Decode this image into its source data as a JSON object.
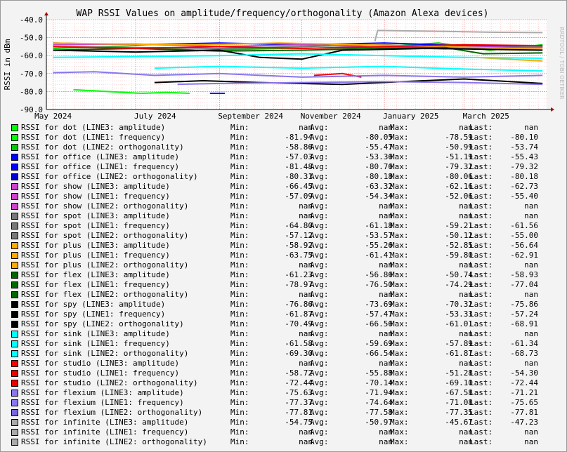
{
  "chart_data": {
    "type": "line",
    "title": "WAP RSSI Values on amplitude/frequency/orthogonality (Amazon Alexa devices)",
    "ylabel": "RSSI in dBm",
    "xlabel": "",
    "ylim": [
      -90,
      -40
    ],
    "y_ticks": [
      "-40.0",
      "-50.0",
      "-60.0",
      "-70.0",
      "-80.0",
      "-90.0"
    ],
    "x_ticks": [
      "May 2024",
      "July 2024",
      "September 2024",
      "November 2024",
      "January 2025",
      "March 2025"
    ],
    "x_range": [
      "2024-04-26",
      "2025-05-01"
    ],
    "grid": true,
    "watermark": "RRDTOOL / TOBI OETIKER",
    "stat_labels": [
      "Min:",
      "Avg:",
      "Max:",
      "Last:"
    ],
    "series": [
      {
        "name": "RSSI for dot (LINE3: amplitude)",
        "color": "#00ff00",
        "min": "nan",
        "avg": "nan",
        "max": "nan",
        "last": "nan",
        "points": []
      },
      {
        "name": "RSSI for dot (LINE1: frequency)",
        "color": "#00ff00",
        "min": "-81.94",
        "avg": "-80.05",
        "max": "-78.59",
        "last": "-80.10",
        "points": [
          [
            "2024-05-16",
            -79
          ],
          [
            "2024-06-10",
            -80
          ],
          [
            "2024-07-05",
            -81
          ],
          [
            "2024-07-25",
            -80.5
          ],
          [
            "2024-08-10",
            -81
          ]
        ]
      },
      {
        "name": "RSSI for dot (LINE2: orthogonality)",
        "color": "#00cc00",
        "min": "-58.86",
        "avg": "-55.47",
        "max": "-50.99",
        "last": "-53.74",
        "points": [
          [
            "2024-05-01",
            -56
          ],
          [
            "2024-06-15",
            -55
          ],
          [
            "2024-08-15",
            -57
          ],
          [
            "2024-10-15",
            -56
          ],
          [
            "2024-12-20",
            -55.5
          ],
          [
            "2025-02-10",
            -53
          ],
          [
            "2025-03-20",
            -57
          ],
          [
            "2025-04-28",
            -54
          ]
        ]
      },
      {
        "name": "RSSI for office (LINE3: amplitude)",
        "color": "#0000ff",
        "min": "-57.03",
        "avg": "-53.36",
        "max": "-51.19",
        "last": "-55.43",
        "points": [
          [
            "2024-05-01",
            -53
          ],
          [
            "2024-07-01",
            -54
          ],
          [
            "2024-09-01",
            -53
          ],
          [
            "2024-11-01",
            -54
          ],
          [
            "2025-01-01",
            -53
          ],
          [
            "2025-03-01",
            -54.5
          ],
          [
            "2025-04-28",
            -55
          ]
        ]
      },
      {
        "name": "RSSI for office (LINE1: frequency)",
        "color": "#0000ff",
        "min": "-81.48",
        "avg": "-80.76",
        "max": "-79.32",
        "last": "-79.32",
        "points": [
          [
            "2024-08-25",
            -81
          ],
          [
            "2024-09-05",
            -81
          ]
        ]
      },
      {
        "name": "RSSI for office (LINE2: orthogonality)",
        "color": "#0000cc",
        "min": "-80.31",
        "avg": "-80.18",
        "max": "-80.06",
        "last": "-80.18",
        "points": []
      },
      {
        "name": "RSSI for show (LINE3: amplitude)",
        "color": "#cc44cc",
        "min": "-66.45",
        "avg": "-63.32",
        "max": "-62.16",
        "last": "-62.73",
        "points": []
      },
      {
        "name": "RSSI for show (LINE1: frequency)",
        "color": "#cc44cc",
        "min": "-57.09",
        "avg": "-54.34",
        "max": "-52.06",
        "last": "-55.40",
        "points": [
          [
            "2024-05-01",
            -54
          ],
          [
            "2024-07-01",
            -53.5
          ],
          [
            "2024-09-01",
            -55
          ],
          [
            "2024-11-01",
            -54
          ],
          [
            "2025-01-01",
            -55.5
          ],
          [
            "2025-03-01",
            -55
          ],
          [
            "2025-04-28",
            -55.5
          ]
        ]
      },
      {
        "name": "RSSI for show (LINE2: orthogonality)",
        "color": "#cc44cc",
        "min": "nan",
        "avg": "nan",
        "max": "nan",
        "last": "nan",
        "points": []
      },
      {
        "name": "RSSI for spot (LINE3: amplitude)",
        "color": "#777777",
        "min": "nan",
        "avg": "nan",
        "max": "nan",
        "last": "nan",
        "points": []
      },
      {
        "name": "RSSI for spot (LINE1: frequency)",
        "color": "#777777",
        "min": "-64.80",
        "avg": "-61.18",
        "max": "-59.21",
        "last": "-61.56",
        "points": []
      },
      {
        "name": "RSSI for spot (LINE2: orthogonality)",
        "color": "#777777",
        "min": "-57.12",
        "avg": "-53.57",
        "max": "-50.12",
        "last": "-55.00",
        "points": [
          [
            "2024-05-01",
            -55
          ],
          [
            "2024-07-01",
            -55.5
          ],
          [
            "2024-09-01",
            -56
          ],
          [
            "2024-11-01",
            -55
          ],
          [
            "2025-01-01",
            -54
          ],
          [
            "2025-03-01",
            -56
          ],
          [
            "2025-04-28",
            -55
          ]
        ]
      },
      {
        "name": "RSSI for plus (LINE3: amplitude)",
        "color": "#ffaa00",
        "min": "-58.92",
        "avg": "-55.26",
        "max": "-52.85",
        "last": "-56.64",
        "points": [
          [
            "2024-05-01",
            -53
          ],
          [
            "2024-06-15",
            -53.5
          ],
          [
            "2024-08-15",
            -54
          ],
          [
            "2024-10-15",
            -53
          ],
          [
            "2024-12-15",
            -54
          ],
          [
            "2025-02-15",
            -55
          ],
          [
            "2025-04-28",
            -56.5
          ]
        ]
      },
      {
        "name": "RSSI for plus (LINE1: frequency)",
        "color": "#ffaa00",
        "min": "-63.75",
        "avg": "-61.41",
        "max": "-59.80",
        "last": "-62.91",
        "points": [
          [
            "2025-03-10",
            -61
          ],
          [
            "2025-04-01",
            -62
          ],
          [
            "2025-04-28",
            -63
          ]
        ]
      },
      {
        "name": "RSSI for plus (LINE2: orthogonality)",
        "color": "#ffaa00",
        "min": "nan",
        "avg": "nan",
        "max": "nan",
        "last": "nan",
        "points": []
      },
      {
        "name": "RSSI for flex (LINE3: amplitude)",
        "color": "#006600",
        "min": "-61.23",
        "avg": "-56.86",
        "max": "-50.74",
        "last": "-58.93",
        "points": [
          [
            "2024-05-01",
            -57
          ],
          [
            "2024-07-01",
            -56
          ],
          [
            "2024-09-01",
            -57.5
          ],
          [
            "2024-11-01",
            -57
          ],
          [
            "2025-01-01",
            -56
          ],
          [
            "2025-02-15",
            -55.5
          ],
          [
            "2025-03-15",
            -59
          ],
          [
            "2025-04-28",
            -58.5
          ]
        ]
      },
      {
        "name": "RSSI for flex (LINE1: frequency)",
        "color": "#006600",
        "min": "-78.97",
        "avg": "-76.50",
        "max": "-74.29",
        "last": "-77.04",
        "points": []
      },
      {
        "name": "RSSI for flex (LINE2: orthogonality)",
        "color": "#006600",
        "min": "nan",
        "avg": "nan",
        "max": "nan",
        "last": "nan",
        "points": []
      },
      {
        "name": "RSSI for spy (LINE3: amplitude)",
        "color": "#000000",
        "min": "-76.86",
        "avg": "-73.69",
        "max": "-70.32",
        "last": "-75.86",
        "points": [
          [
            "2024-07-15",
            -75
          ],
          [
            "2024-08-20",
            -74
          ],
          [
            "2024-10-01",
            -75
          ],
          [
            "2024-12-01",
            -76
          ],
          [
            "2025-01-15",
            -74.5
          ],
          [
            "2025-03-01",
            -73
          ],
          [
            "2025-04-28",
            -75.5
          ]
        ]
      },
      {
        "name": "RSSI for spy (LINE1: frequency)",
        "color": "#000000",
        "min": "-61.87",
        "avg": "-57.47",
        "max": "-53.33",
        "last": "-57.24",
        "points": [
          [
            "2024-05-01",
            -57
          ],
          [
            "2024-07-01",
            -58
          ],
          [
            "2024-09-01",
            -57
          ],
          [
            "2024-10-01",
            -61
          ],
          [
            "2024-11-01",
            -62
          ],
          [
            "2024-12-01",
            -57
          ],
          [
            "2025-02-01",
            -56
          ],
          [
            "2025-04-28",
            -57
          ]
        ]
      },
      {
        "name": "RSSI for spy (LINE2: orthogonality)",
        "color": "#000000",
        "min": "-70.49",
        "avg": "-66.56",
        "max": "-61.01",
        "last": "-68.91",
        "points": []
      },
      {
        "name": "RSSI for sink (LINE3: amplitude)",
        "color": "#00ffff",
        "min": "nan",
        "avg": "nan",
        "max": "nan",
        "last": "nan",
        "points": []
      },
      {
        "name": "RSSI for sink (LINE1: frequency)",
        "color": "#00ffff",
        "min": "-61.58",
        "avg": "-59.69",
        "max": "-57.89",
        "last": "-61.34",
        "points": [
          [
            "2024-05-01",
            -61
          ],
          [
            "2024-07-01",
            -60.5
          ],
          [
            "2024-09-01",
            -60
          ],
          [
            "2024-11-01",
            -59
          ],
          [
            "2025-01-01",
            -60
          ],
          [
            "2025-03-01",
            -61
          ],
          [
            "2025-04-28",
            -61.5
          ]
        ]
      },
      {
        "name": "RSSI for sink (LINE2: orthogonality)",
        "color": "#00ffff",
        "min": "-69.30",
        "avg": "-66.54",
        "max": "-61.87",
        "last": "-68.73",
        "points": [
          [
            "2024-07-15",
            -67
          ],
          [
            "2024-09-01",
            -66
          ],
          [
            "2024-11-01",
            -67
          ],
          [
            "2025-01-01",
            -66
          ],
          [
            "2025-03-01",
            -67.5
          ],
          [
            "2025-04-28",
            -68.5
          ]
        ]
      },
      {
        "name": "RSSI for studio (LINE3: amplitude)",
        "color": "#ff0000",
        "min": "nan",
        "avg": "nan",
        "max": "nan",
        "last": "nan",
        "points": []
      },
      {
        "name": "RSSI for studio (LINE1: frequency)",
        "color": "#ee0000",
        "min": "-58.72",
        "avg": "-55.88",
        "max": "-51.28",
        "last": "-54.30",
        "points": [
          [
            "2024-05-01",
            -55
          ],
          [
            "2024-07-01",
            -56
          ],
          [
            "2024-09-01",
            -55
          ],
          [
            "2024-11-01",
            -56
          ],
          [
            "2025-01-01",
            -55
          ],
          [
            "2025-03-01",
            -54
          ],
          [
            "2025-04-28",
            -54.5
          ]
        ]
      },
      {
        "name": "RSSI for studio (LINE2: orthogonality)",
        "color": "#ee0000",
        "min": "-72.44",
        "avg": "-70.14",
        "max": "-69.10",
        "last": "-72.44",
        "points": [
          [
            "2024-11-10",
            -71
          ],
          [
            "2024-12-01",
            -70
          ],
          [
            "2024-12-15",
            -72
          ]
        ]
      },
      {
        "name": "RSSI for flexium (LINE3: amplitude)",
        "color": "#8877ee",
        "min": "-75.63",
        "avg": "-71.94",
        "max": "-67.58",
        "last": "-71.21",
        "points": [
          [
            "2024-05-01",
            -69.5
          ],
          [
            "2024-06-01",
            -69
          ],
          [
            "2024-07-15",
            -71
          ],
          [
            "2024-09-01",
            -70
          ],
          [
            "2024-11-01",
            -72
          ],
          [
            "2025-01-01",
            -71
          ],
          [
            "2025-03-01",
            -72
          ],
          [
            "2025-04-28",
            -71
          ]
        ]
      },
      {
        "name": "RSSI for flexium (LINE1: frequency)",
        "color": "#8877ee",
        "min": "-77.37",
        "avg": "-74.64",
        "max": "-71.08",
        "last": "-75.65",
        "points": [
          [
            "2024-08-01",
            -76
          ],
          [
            "2024-09-01",
            -75.5
          ],
          [
            "2024-11-01",
            -75
          ],
          [
            "2025-01-01",
            -74.5
          ],
          [
            "2025-03-01",
            -75
          ],
          [
            "2025-04-28",
            -76
          ]
        ]
      },
      {
        "name": "RSSI for flexium (LINE2: orthogonality)",
        "color": "#7766dd",
        "min": "-77.81",
        "avg": "-77.58",
        "max": "-77.35",
        "last": "-77.81",
        "points": []
      },
      {
        "name": "RSSI for infinite (LINE3: amplitude)",
        "color": "#aaaaaa",
        "min": "-54.75",
        "avg": "-50.97",
        "max": "-45.67",
        "last": "-47.23",
        "points": [
          [
            "2024-12-25",
            -52
          ],
          [
            "2024-12-27",
            -46
          ],
          [
            "2025-02-10",
            -46.5
          ],
          [
            "2025-03-20",
            -47
          ],
          [
            "2025-04-28",
            -47.2
          ]
        ]
      },
      {
        "name": "RSSI for infinite (LINE1: frequency)",
        "color": "#aaaaaa",
        "min": "nan",
        "avg": "nan",
        "max": "nan",
        "last": "nan",
        "points": []
      },
      {
        "name": "RSSI for infinite (LINE2: orthogonality)",
        "color": "#aaaaaa",
        "min": "nan",
        "avg": "nan",
        "max": "nan",
        "last": "nan",
        "points": []
      }
    ]
  }
}
